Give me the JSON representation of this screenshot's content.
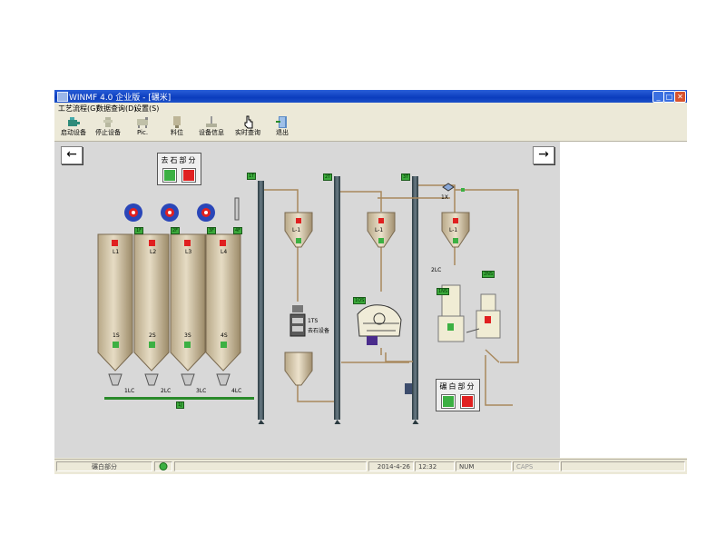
{
  "window": {
    "title": "WINMF 4.0 企业版 - [碾米]",
    "controls": {
      "minimize": "_",
      "maximize": "□",
      "close": "✕"
    }
  },
  "menu": [
    "工艺流程(G)",
    "数据查询(D)",
    "设置(S)"
  ],
  "toolbar": [
    {
      "label": "启动设备",
      "icon": "motor-icon"
    },
    {
      "label": "停止设备",
      "icon": "stop-icon"
    },
    {
      "label": "Pic.",
      "icon": "picture-icon"
    },
    {
      "label": "料位",
      "icon": "level-icon"
    },
    {
      "label": "设备信息",
      "icon": "info-icon"
    },
    {
      "label": "实时查询",
      "icon": "hand-pointer-icon"
    },
    {
      "label": "退出",
      "icon": "exit-door-icon"
    }
  ],
  "nav": {
    "prev": "←",
    "next": "→"
  },
  "panels": {
    "qushi": {
      "title": "去石部分",
      "start_color": "#3cb043",
      "stop_color": "#e02020"
    },
    "nianmi": {
      "title": "碾白部分",
      "start_color": "#3cb043",
      "stop_color": "#e02020"
    }
  },
  "labels": {
    "fans": [
      "1F",
      "2F",
      "3F",
      "4F"
    ],
    "silo_top": [
      "L1",
      "L2",
      "L3",
      "L4"
    ],
    "silo_bottom": [
      "1S",
      "2S",
      "3S",
      "4S"
    ],
    "gates": [
      "1LC",
      "2LC",
      "3LC",
      "4LC"
    ],
    "elevators": [
      "1T",
      "2T",
      "3T"
    ],
    "hopper_tags": [
      "L-1",
      "L-1",
      "L-1"
    ],
    "conveyor": "1J",
    "machine_1": "1TS",
    "machine_1_name": "去石设备",
    "machine_2": "1QS",
    "machine_3": [
      "1NS",
      "2NS"
    ],
    "valve": "1X",
    "screw": "2LC"
  },
  "status": {
    "mode": "碾白部分",
    "date": "2014-4-26",
    "time": "12:32",
    "field_1": "NUM",
    "field_2": "CAPS"
  }
}
